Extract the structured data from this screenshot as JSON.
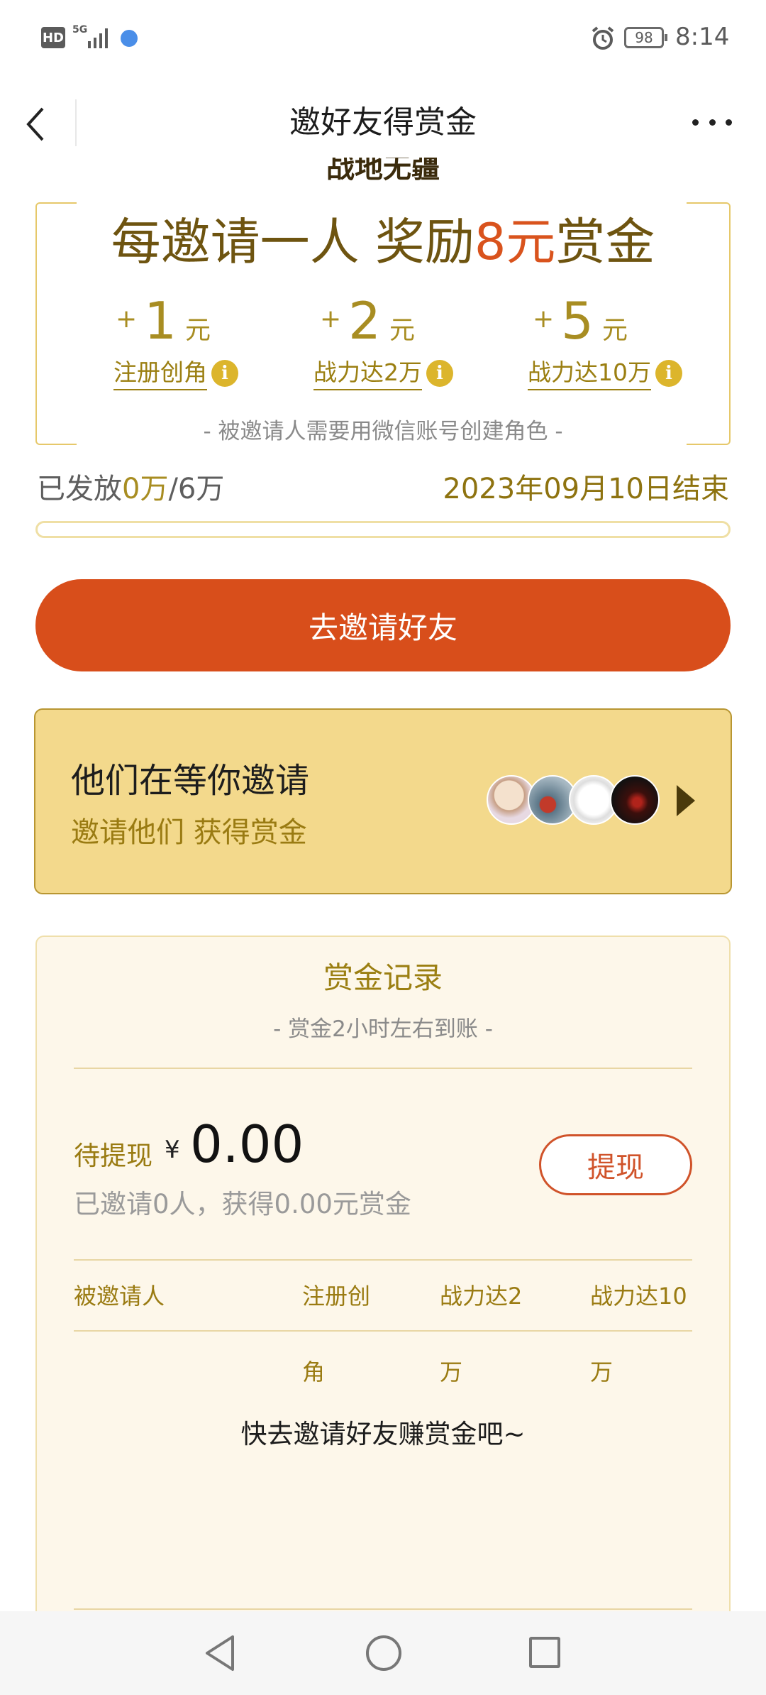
{
  "status_bar": {
    "hd_badge": "HD",
    "network": "5G",
    "battery": "98",
    "time": "8:14"
  },
  "nav": {
    "title": "邀好友得赏金"
  },
  "reward": {
    "partial_heading": "战地无疆",
    "headline_prefix": "每邀请一人 奖励",
    "headline_amount": "8元",
    "headline_suffix": "赏金",
    "tiers": [
      {
        "plus": "+",
        "amount": "1",
        "unit": "元",
        "label": "注册创角"
      },
      {
        "plus": "+",
        "amount": "2",
        "unit": "元",
        "label": "战力达2万"
      },
      {
        "plus": "+",
        "amount": "5",
        "unit": "元",
        "label": "战力达10万"
      }
    ],
    "info_glyph": "i",
    "requirement": "- 被邀请人需要用微信账号创建角色 -"
  },
  "progress": {
    "sent_prefix": "已发放",
    "sent_amount": "0万",
    "sent_total": "/6万",
    "end_date": "2023年09月10日结束",
    "fraction": 0
  },
  "invite_button": "去邀请好友",
  "waiting": {
    "title": "他们在等你邀请",
    "subtitle": "邀请他们 获得赏金",
    "avatar_count": 4
  },
  "records": {
    "title": "赏金记录",
    "subtitle": "- 赏金2小时左右到账 -",
    "pending_label": "待提现",
    "currency": "¥",
    "pending_amount": "0.00",
    "stat": "已邀请0人，获得0.00元赏金",
    "withdraw_button": "提现",
    "columns": [
      "被邀请人",
      "注册创",
      "战力达2",
      "战力达10"
    ],
    "columns_wrap": [
      "",
      "角",
      "万",
      "万"
    ],
    "empty_message": "快去邀请好友赚赏金吧~"
  },
  "colors": {
    "accent": "#d84e1b",
    "gold_text": "#9b7f12",
    "card_bg": "#f3d98c",
    "records_bg": "#fdf7ea"
  }
}
